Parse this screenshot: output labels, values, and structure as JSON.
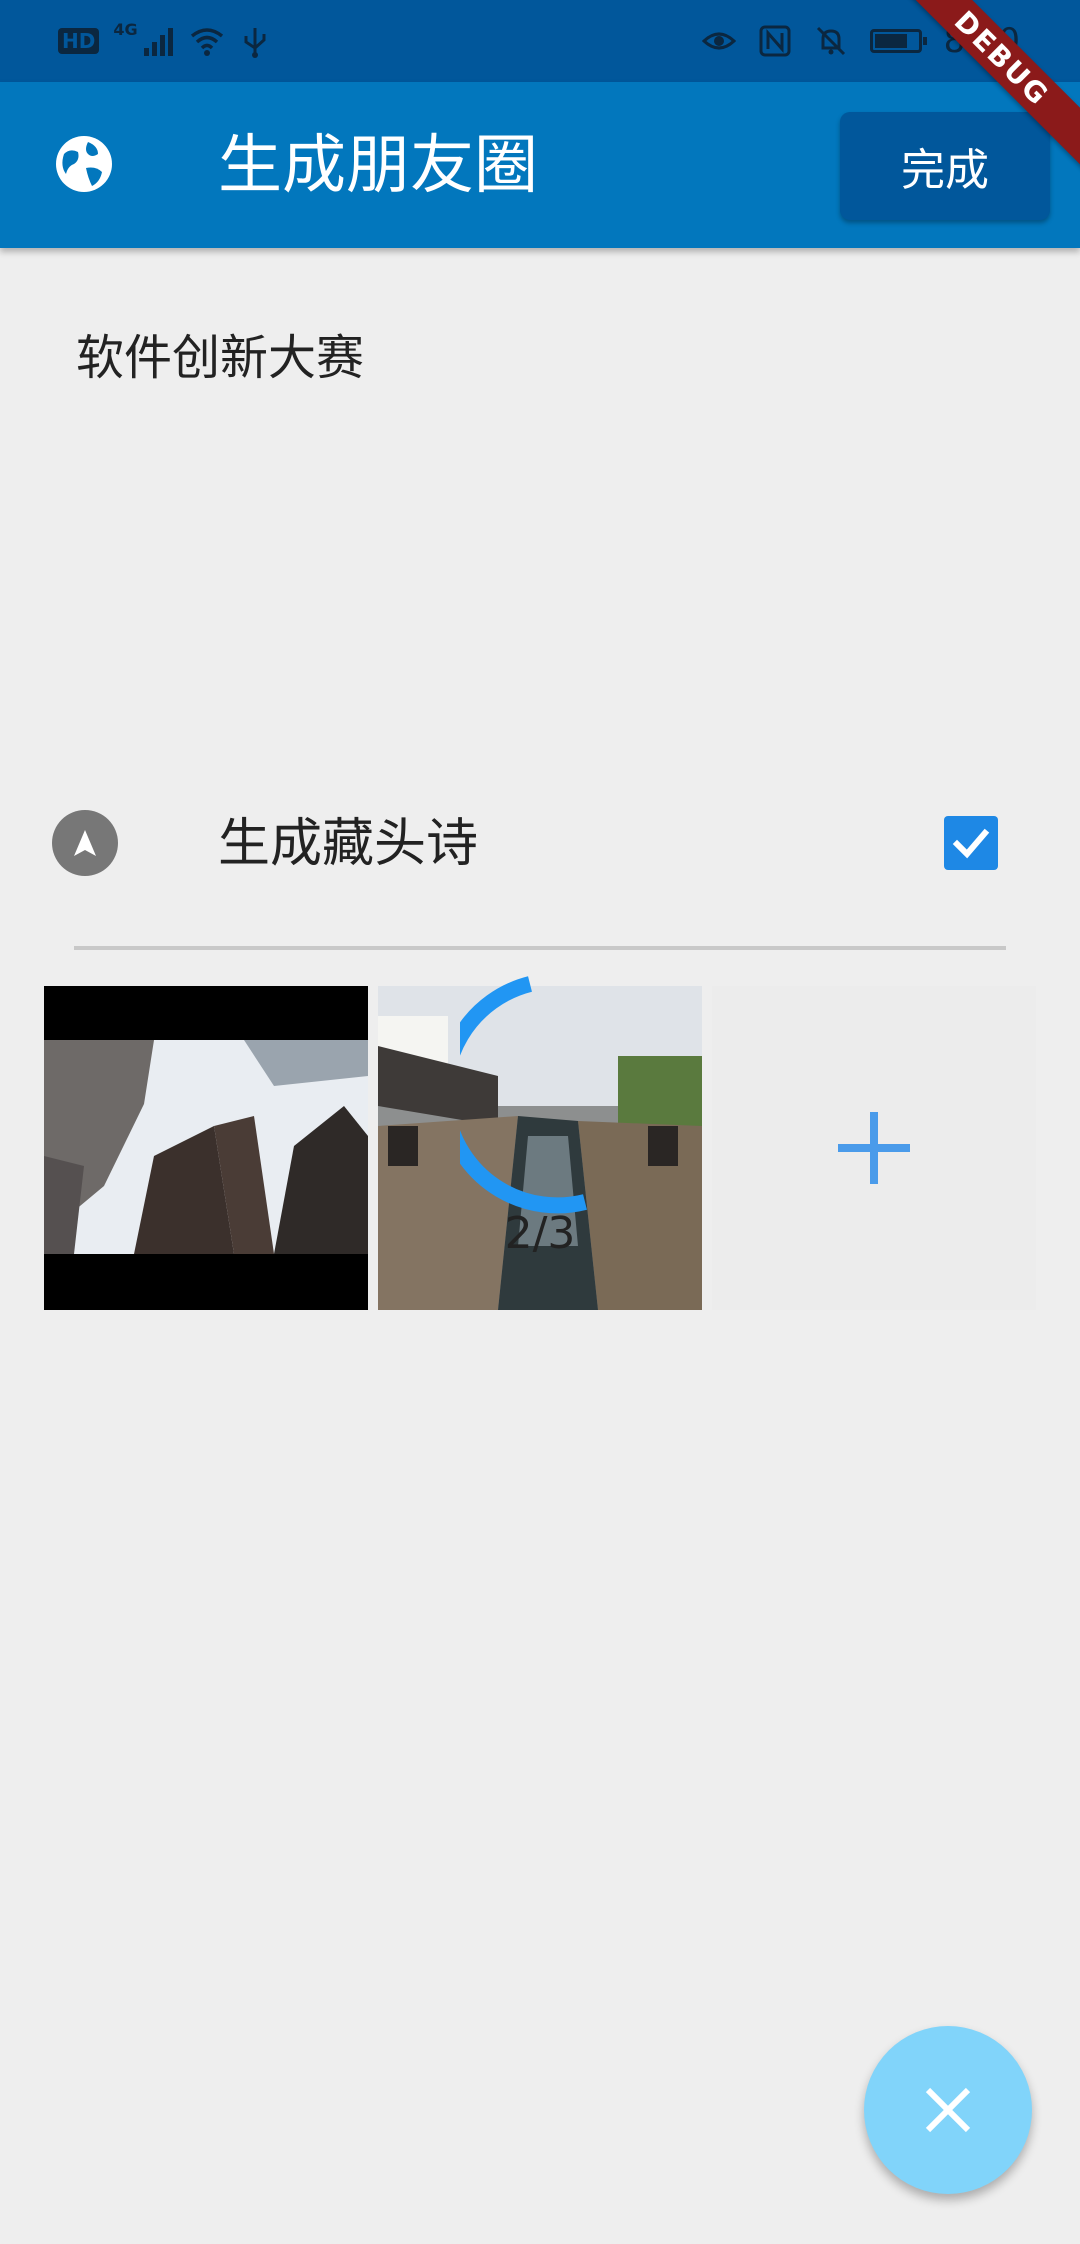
{
  "status_bar": {
    "network_badge": "HD",
    "network_type": "4G",
    "time": "8:50",
    "icons": [
      "signal-icon",
      "wifi-icon",
      "usb-icon",
      "eye-icon",
      "nfc-icon",
      "bell-off-icon",
      "battery-icon"
    ]
  },
  "app_bar": {
    "title": "生成朋友圈",
    "done_label": "完成",
    "leading_icon": "globe-icon"
  },
  "debug_banner": "DEBUG",
  "content": {
    "text": "软件创新大赛"
  },
  "option": {
    "label": "生成藏头诗",
    "checked": true,
    "icon": "navigation-icon"
  },
  "photos": {
    "counter": "2/3",
    "items": [
      "buildings-photo",
      "canal-photo"
    ],
    "add_icon": "plus-icon"
  },
  "fab": {
    "icon": "close-icon"
  },
  "colors": {
    "status_bar": "#01579b",
    "app_bar": "#0277bd",
    "done_button": "#01579b",
    "accent": "#1e88e5",
    "fab": "#81d4fa",
    "background": "#eeeeee"
  }
}
